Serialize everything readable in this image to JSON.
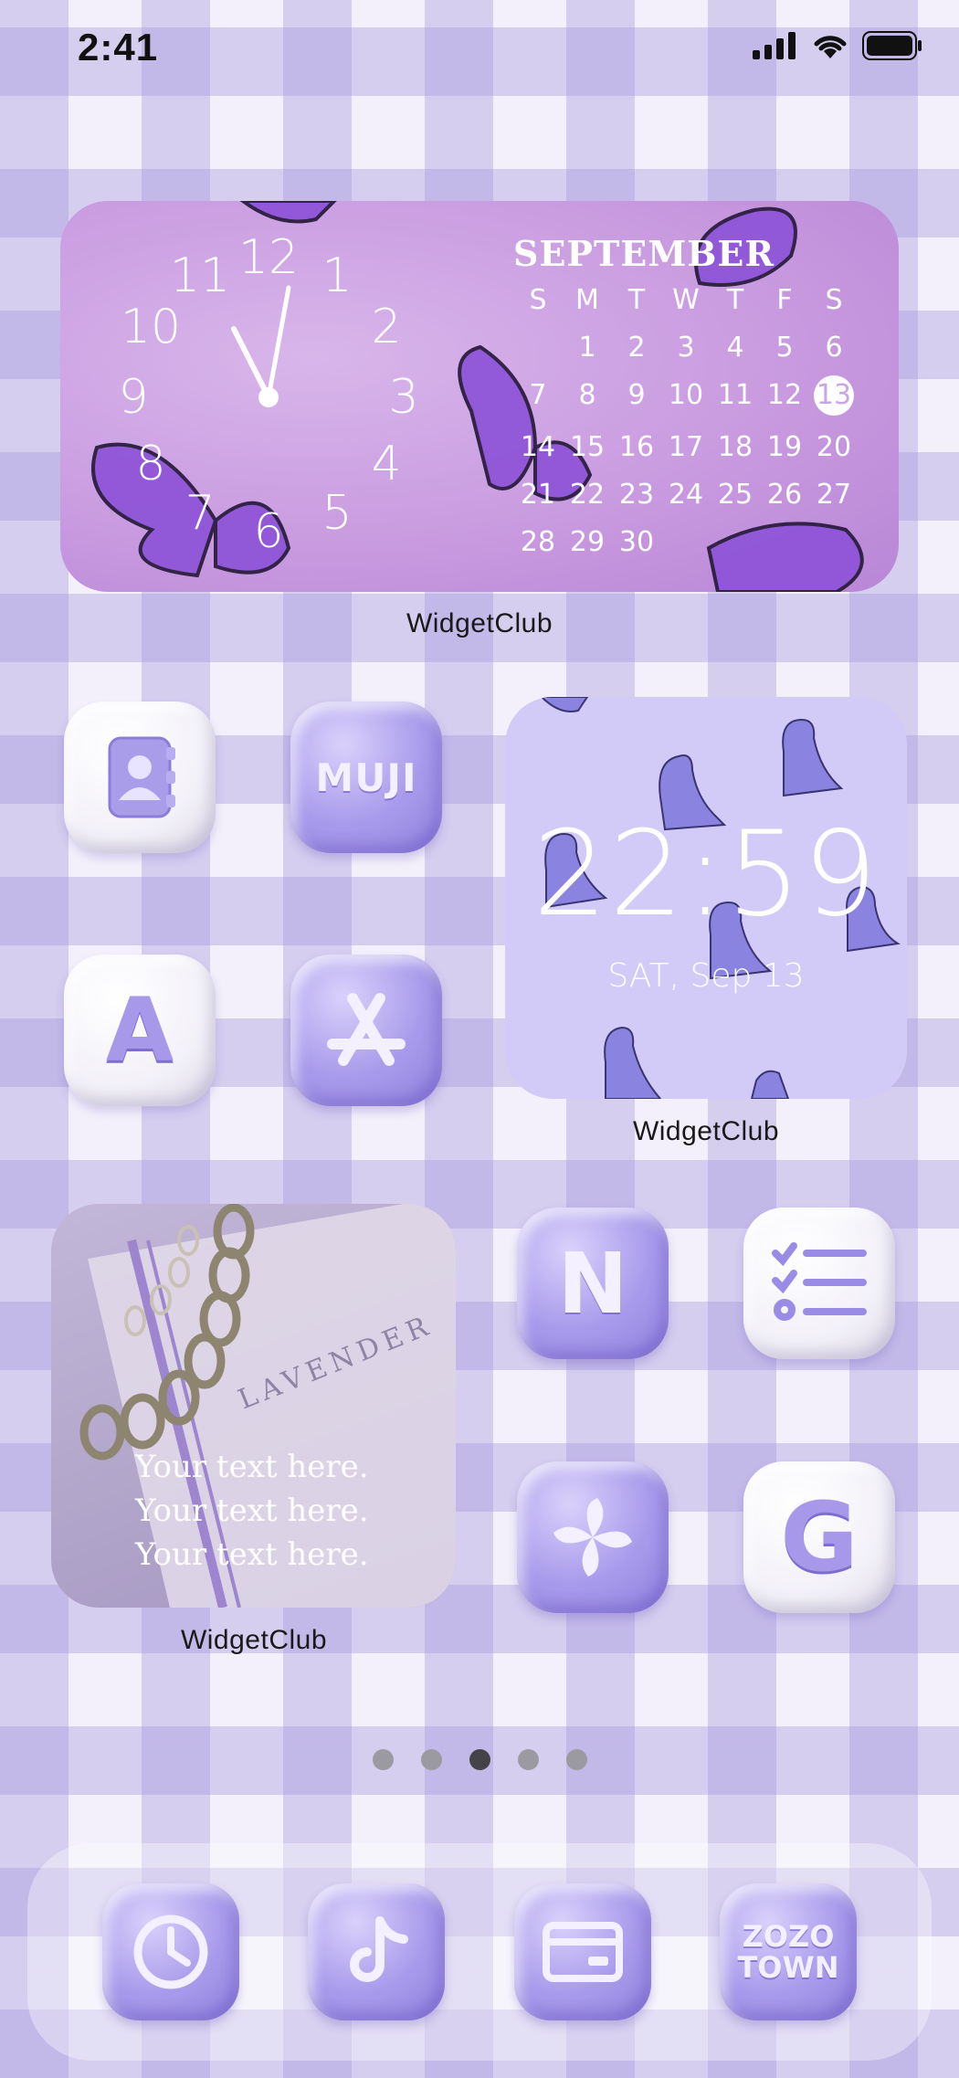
{
  "status_bar": {
    "time": "2:41"
  },
  "calendar_widget": {
    "clock_numbers": [
      "12",
      "1",
      "2",
      "3",
      "4",
      "5",
      "6",
      "7",
      "8",
      "9",
      "10",
      "11"
    ],
    "month": "SEPTEMBER",
    "weekdays": [
      "S",
      "M",
      "T",
      "W",
      "T",
      "F",
      "S"
    ],
    "rows": [
      [
        "",
        "",
        "1",
        "2",
        "3",
        "4",
        "5",
        "6"
      ],
      [
        "7",
        "8",
        "9",
        "10",
        "11",
        "12",
        "13"
      ],
      [
        "14",
        "15",
        "16",
        "17",
        "18",
        "19",
        "20"
      ],
      [
        "21",
        "22",
        "23",
        "24",
        "25",
        "26",
        "27"
      ],
      [
        "28",
        "29",
        "30",
        "",
        "",
        "",
        ""
      ]
    ],
    "today": "13",
    "label": "WidgetClub"
  },
  "icons": {
    "contacts": "contacts-book-icon",
    "muji": "MUJI",
    "font_a": "A",
    "app_store": "app-store-icon",
    "netflix": "N",
    "reminders": "checklist-icon",
    "pinwheel": "pinwheel-icon",
    "google": "G"
  },
  "clock_widget": {
    "time": "22:59",
    "date": "SAT, Sep 13",
    "label": "WidgetClub"
  },
  "photo_widget": {
    "lines": [
      "Your text here.",
      "Your text here.",
      "Your text here."
    ],
    "book_text": "LAVENDER",
    "label": "WidgetClub"
  },
  "page_indicator": {
    "count": 5,
    "active_index": 2
  },
  "dock": {
    "clock": "clock-icon",
    "tiktok": "music-note-icon",
    "wallet": "card-icon",
    "zozo_line1": "ZOZO",
    "zozo_line2": "TOWN"
  },
  "colors": {
    "lavender": "#a89aeb",
    "pink_purple": "#c99be0",
    "dino_bg": "#d3cbf7"
  }
}
